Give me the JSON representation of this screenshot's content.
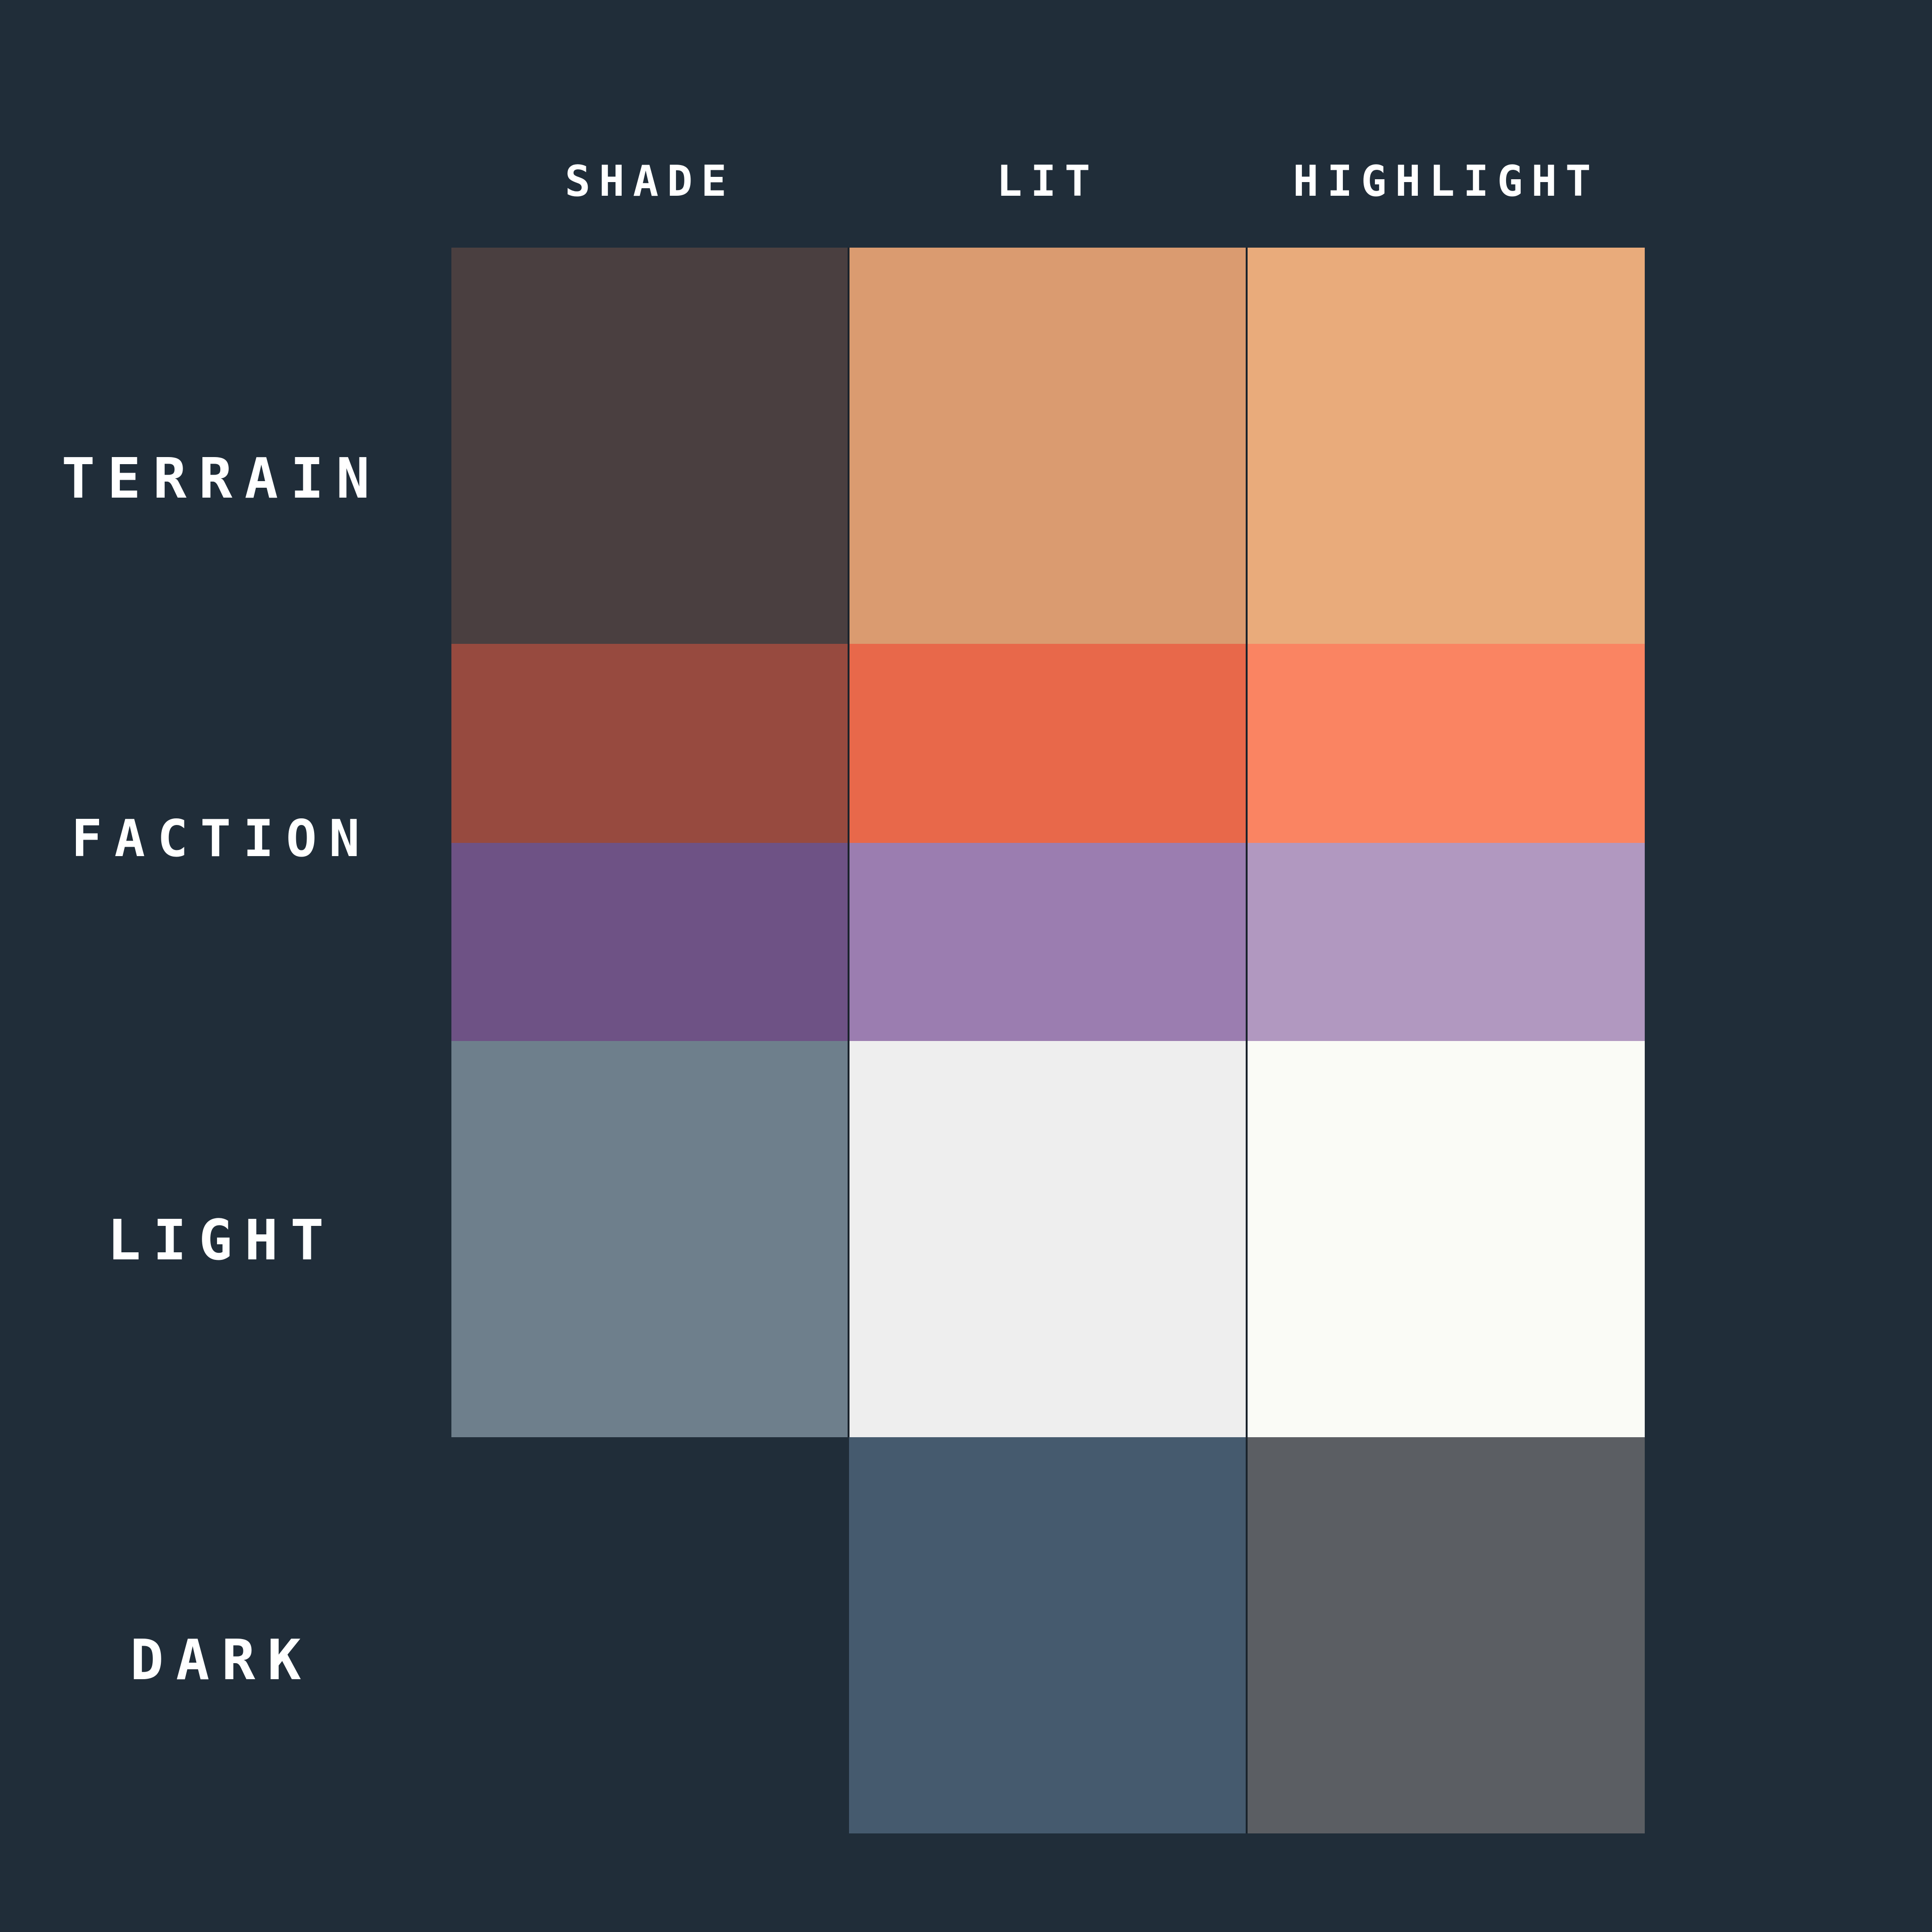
{
  "columns": {
    "shade": "SHADE",
    "lit": "LIT",
    "highlight": "HIGHLIGHT"
  },
  "rows": {
    "terrain": "TERRAIN",
    "faction": "FACTION",
    "light": "LIGHT",
    "dark": "DARK"
  },
  "colors": {
    "background": "#202d39",
    "terrain": {
      "shade": "#4a3f40",
      "lit": "#da9b70",
      "highlight": "#e9ab7b"
    },
    "faction_red": {
      "shade": "#974a3f",
      "lit": "#e8684a",
      "highlight": "#fa8462"
    },
    "faction_purple": {
      "shade": "#6e5285",
      "lit": "#9b7db0",
      "highlight": "#b198c0"
    },
    "light": {
      "shade": "#6e7f8c",
      "lit": "#eeeeee",
      "highlight": "#fafbf6"
    },
    "dark": {
      "lit": "#455a6e",
      "highlight": "#5b5e63"
    }
  }
}
